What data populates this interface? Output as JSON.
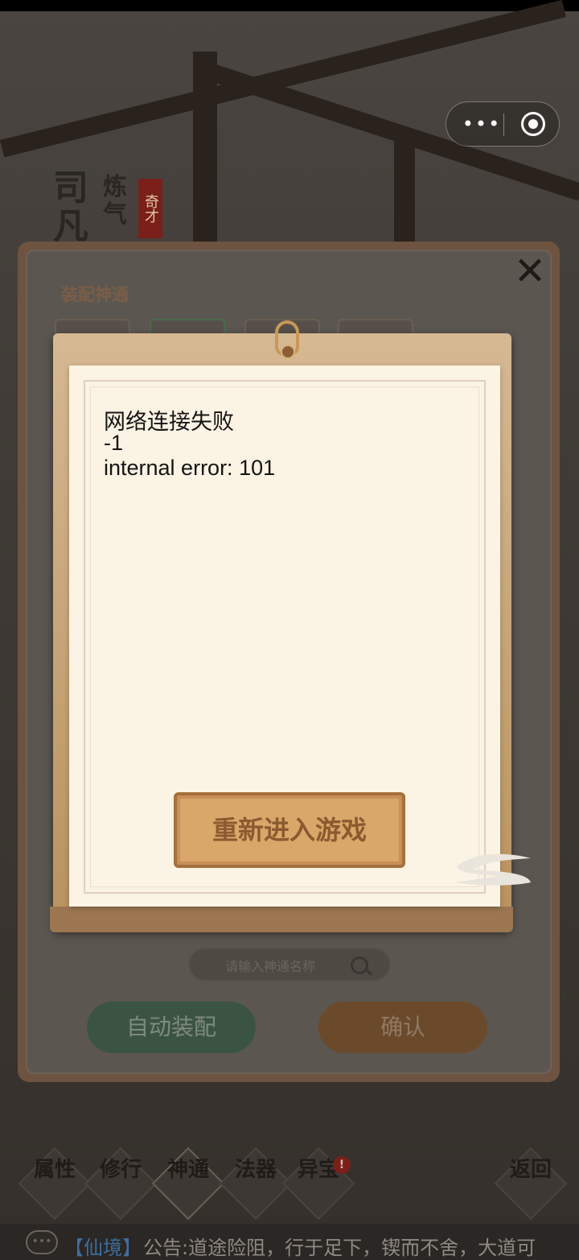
{
  "background": {
    "character_name": "司凡",
    "realm": "炼气",
    "seal": "奇才",
    "panel": {
      "title": "装配神通",
      "close_icon": "x-close",
      "search_placeholder": "请输入神通名称",
      "buttons": {
        "auto_equip": "自动装配",
        "confirm": "确认"
      }
    },
    "bottom_nav": [
      {
        "label": "属性"
      },
      {
        "label": "修行"
      },
      {
        "label": "神通"
      },
      {
        "label": "法器"
      },
      {
        "label": "异宝"
      },
      {
        "label": "返回"
      }
    ],
    "badge": "!",
    "ticker": {
      "tag": "【仙境】",
      "text": "公告:道途险阻，行于足下，锲而不舍，大道可"
    }
  },
  "capsule": {
    "more_label": "•••",
    "record_icon": "target-icon"
  },
  "dialog": {
    "lines": [
      "网络连接失败",
      "-1",
      "internal error: 101"
    ],
    "button": "重新进入游戏"
  },
  "colors": {
    "dialog_paper": "#fbf3e3",
    "dialog_button": "#d9a769",
    "ticker_tag": "#3d6ea0"
  }
}
